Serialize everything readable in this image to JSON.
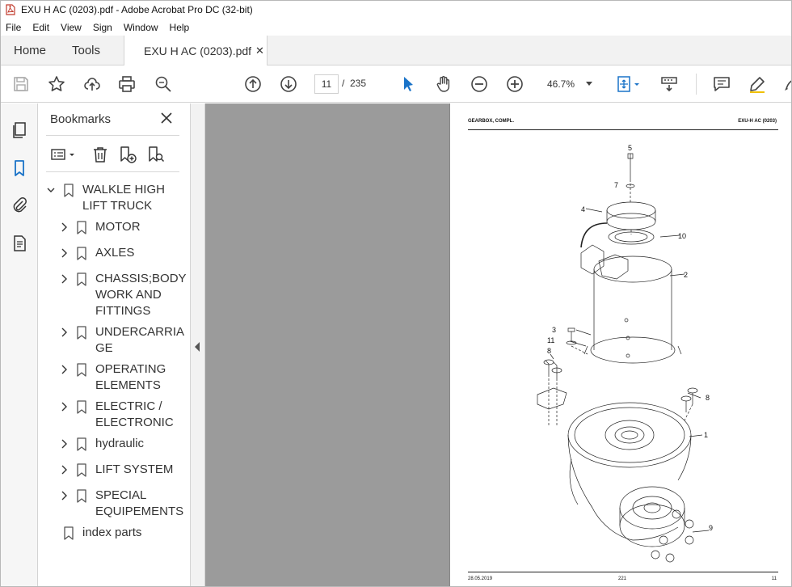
{
  "window": {
    "title": "EXU H AC (0203).pdf - Adobe Acrobat Pro DC (32-bit)"
  },
  "menu": [
    "File",
    "Edit",
    "View",
    "Sign",
    "Window",
    "Help"
  ],
  "tabs": {
    "home": "Home",
    "tools": "Tools",
    "document": "EXU H AC (0203).pdf",
    "close": "✕"
  },
  "toolbar": {
    "current_page": "11",
    "separator": "/",
    "total_pages": "235",
    "zoom": "46.7%"
  },
  "bookmarks": {
    "title": "Bookmarks",
    "items": [
      {
        "label": "WALKLE HIGH LIFT TRUCK",
        "expanded": true
      },
      {
        "label": "MOTOR"
      },
      {
        "label": "AXLES"
      },
      {
        "label": "CHASSIS;BODY WORK AND FITTINGS"
      },
      {
        "label": "UNDERCARRIAGE"
      },
      {
        "label": "OPERATING ELEMENTS"
      },
      {
        "label": "ELECTRIC / ELECTRONIC"
      },
      {
        "label": "hydraulic"
      },
      {
        "label": "LIFT SYSTEM"
      },
      {
        "label": "SPECIAL EQUIPEMENTS"
      },
      {
        "label": "index parts"
      }
    ]
  },
  "page": {
    "header_left": "GEARBOX, COMPL.",
    "header_right": "EXU-H AC (0203)",
    "footer_left": "28.05.2019",
    "footer_center": "221",
    "footer_right": "11",
    "callouts": [
      "5",
      "7",
      "4",
      "10",
      "2",
      "3",
      "11",
      "8",
      "8",
      "1",
      "9"
    ]
  },
  "colors": {
    "accent_blue": "#1a73c8",
    "canvas_gray": "#9b9b9b"
  }
}
